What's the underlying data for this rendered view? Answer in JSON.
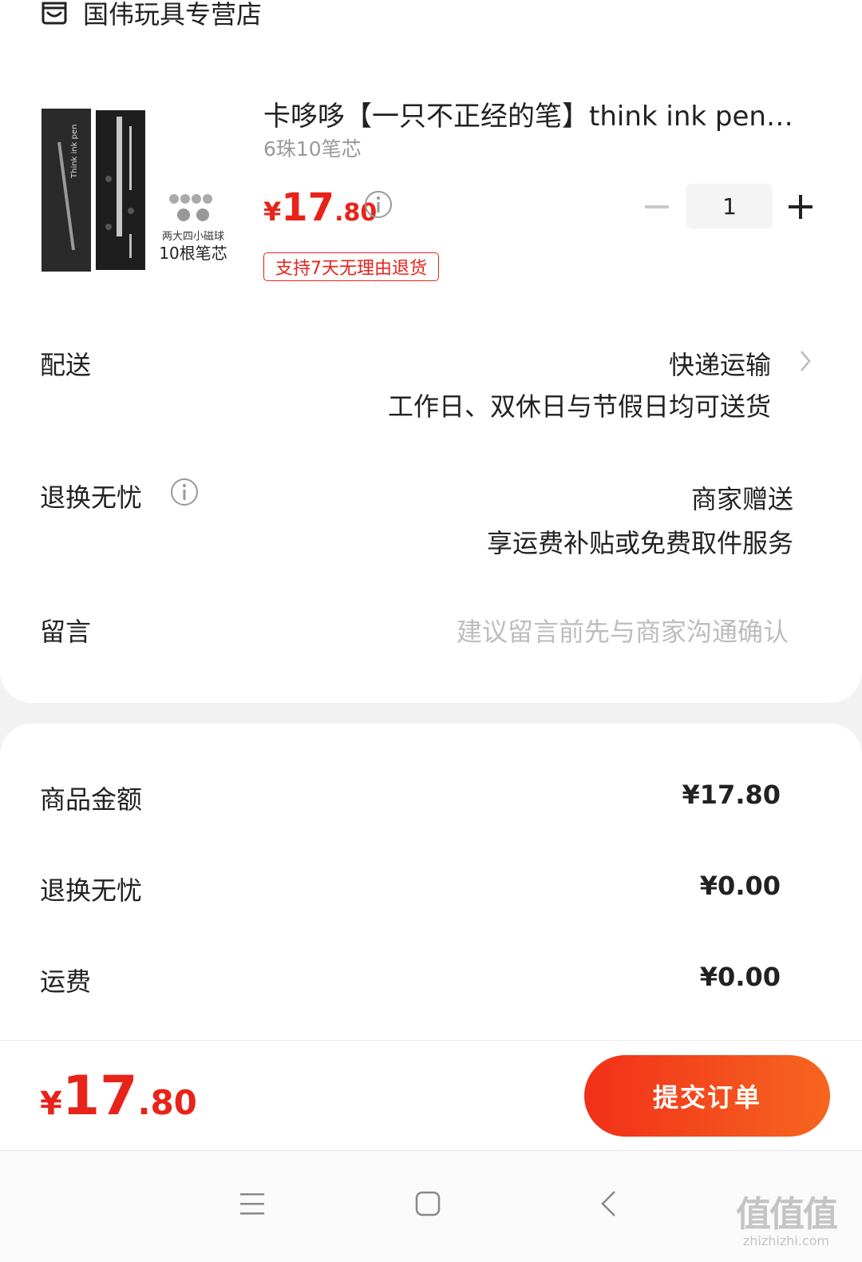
{
  "store": {
    "name": "国伟玩具专营店",
    "icon": "store-icon"
  },
  "product": {
    "title": "卡哆哆【一只不正经的笔】think ink pen…",
    "spec": "6珠10笔芯",
    "price_symbol": "¥",
    "price_int": "17",
    "price_dec": ".80",
    "quantity": "1",
    "return_tag": "支持7天无理由退货",
    "image": {
      "box_text": "Think ink pen",
      "caption_small": "两大四小磁球",
      "caption_large": "10根笔芯"
    }
  },
  "delivery": {
    "label": "配送",
    "method": "快递运输",
    "note": "工作日、双休日与节假日均可送货"
  },
  "returns": {
    "label": "退换无忧",
    "value": "商家赠送",
    "note": "享运费补贴或免费取件服务"
  },
  "message": {
    "label": "留言",
    "placeholder": "建议留言前先与商家沟通确认"
  },
  "summary": [
    {
      "label": "商品金额",
      "value": "¥17.80"
    },
    {
      "label": "退换无忧",
      "value": "¥0.00"
    },
    {
      "label": "运费",
      "value": "¥0.00"
    }
  ],
  "footer": {
    "total_symbol": "¥",
    "total_int": "17",
    "total_dec": ".80",
    "submit_label": "提交订单"
  },
  "watermark": {
    "main": "值值值",
    "sub": "zhizhizhi.com"
  },
  "colors": {
    "accent": "#e8231a",
    "button_start": "#f1301a",
    "button_end": "#f6661f"
  }
}
